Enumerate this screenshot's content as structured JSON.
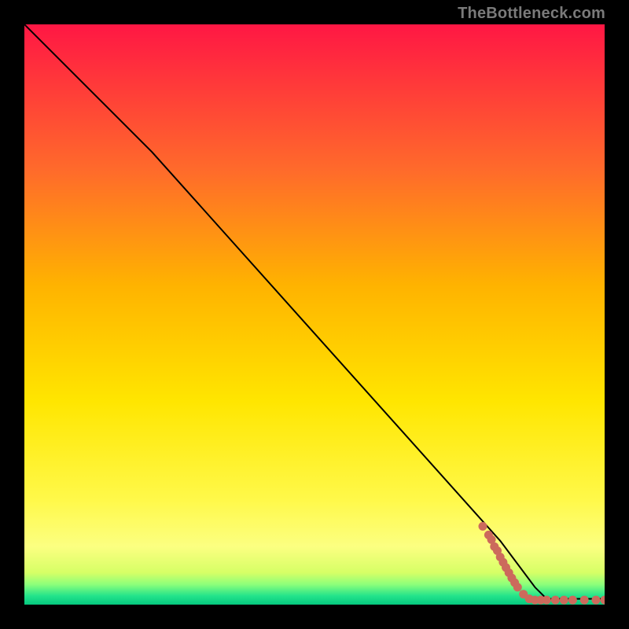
{
  "watermark": "TheBottleneck.com",
  "chart_data": {
    "type": "line",
    "title": "",
    "xlabel": "",
    "ylabel": "",
    "xlim": [
      0,
      100
    ],
    "ylim": [
      0,
      100
    ],
    "background_gradient": [
      {
        "pos": 0.0,
        "color": "#ff1744"
      },
      {
        "pos": 0.25,
        "color": "#ff6a2b"
      },
      {
        "pos": 0.45,
        "color": "#ffb300"
      },
      {
        "pos": 0.65,
        "color": "#ffe600"
      },
      {
        "pos": 0.82,
        "color": "#fff94a"
      },
      {
        "pos": 0.9,
        "color": "#fcff81"
      },
      {
        "pos": 0.945,
        "color": "#d6ff66"
      },
      {
        "pos": 0.965,
        "color": "#8dff7a"
      },
      {
        "pos": 0.985,
        "color": "#23e38b"
      },
      {
        "pos": 1.0,
        "color": "#05c97f"
      }
    ],
    "series": [
      {
        "name": "curve",
        "style": "solid",
        "color": "#000000",
        "data": [
          {
            "x": 0,
            "y": 100
          },
          {
            "x": 22,
            "y": 78
          },
          {
            "x": 82,
            "y": 11
          },
          {
            "x": 88,
            "y": 3
          },
          {
            "x": 90,
            "y": 1
          },
          {
            "x": 100,
            "y": 1
          }
        ]
      },
      {
        "name": "data-points",
        "style": "markers",
        "color": "#cc6a5c",
        "data": [
          {
            "x": 79,
            "y": 13.5
          },
          {
            "x": 80,
            "y": 12.0
          },
          {
            "x": 80.5,
            "y": 11.2
          },
          {
            "x": 81,
            "y": 10.0
          },
          {
            "x": 81.5,
            "y": 9.3
          },
          {
            "x": 82,
            "y": 8.2
          },
          {
            "x": 82.5,
            "y": 7.3
          },
          {
            "x": 83,
            "y": 6.4
          },
          {
            "x": 83.5,
            "y": 5.5
          },
          {
            "x": 84,
            "y": 4.6
          },
          {
            "x": 84.5,
            "y": 3.8
          },
          {
            "x": 85,
            "y": 3.0
          },
          {
            "x": 86,
            "y": 1.8
          },
          {
            "x": 87,
            "y": 1.0
          },
          {
            "x": 88,
            "y": 0.8
          },
          {
            "x": 89,
            "y": 0.8
          },
          {
            "x": 90,
            "y": 0.8
          },
          {
            "x": 91.5,
            "y": 0.8
          },
          {
            "x": 93,
            "y": 0.8
          },
          {
            "x": 94.5,
            "y": 0.8
          },
          {
            "x": 96.5,
            "y": 0.8
          },
          {
            "x": 98.5,
            "y": 0.8
          },
          {
            "x": 100,
            "y": 0.8
          }
        ]
      }
    ]
  }
}
